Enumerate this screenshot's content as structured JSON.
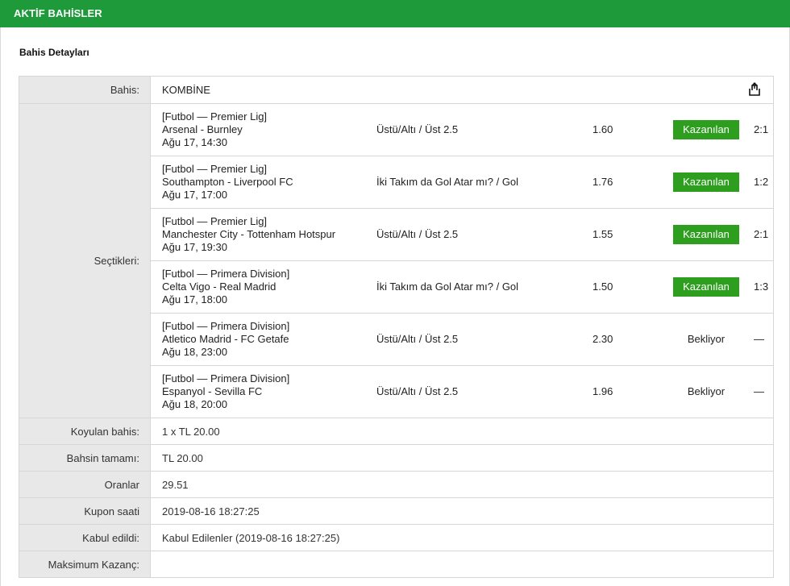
{
  "header": {
    "title": "AKTİF BAHİSLER"
  },
  "section_title": "Bahis Detayları",
  "bet": {
    "label": "Bahis:",
    "type": "KOMBİNE"
  },
  "selections": {
    "label": "Seçtikleri:",
    "items": [
      {
        "league": "[Futbol — Premier Lig]",
        "match": "Arsenal - Burnley",
        "date": "Ağu 17, 14:30",
        "market": "Üstü/Altı / Üst 2.5",
        "odds": "1.60",
        "status": "Kazanılan",
        "won": true,
        "score": "2:1"
      },
      {
        "league": "[Futbol — Premier Lig]",
        "match": "Southampton - Liverpool FC",
        "date": "Ağu 17, 17:00",
        "market": "İki Takım da Gol Atar mı? / Gol",
        "odds": "1.76",
        "status": "Kazanılan",
        "won": true,
        "score": "1:2"
      },
      {
        "league": "[Futbol — Premier Lig]",
        "match": "Manchester City - Tottenham Hotspur",
        "date": "Ağu 17, 19:30",
        "market": "Üstü/Altı / Üst 2.5",
        "odds": "1.55",
        "status": "Kazanılan",
        "won": true,
        "score": "2:1"
      },
      {
        "league": "[Futbol — Primera Division]",
        "match": "Celta Vigo - Real Madrid",
        "date": "Ağu 17, 18:00",
        "market": "İki Takım da Gol Atar mı? / Gol",
        "odds": "1.50",
        "status": "Kazanılan",
        "won": true,
        "score": "1:3"
      },
      {
        "league": "[Futbol — Primera Division]",
        "match": "Atletico Madrid - FC Getafe",
        "date": "Ağu 18, 23:00",
        "market": "Üstü/Altı / Üst 2.5",
        "odds": "2.30",
        "status": "Bekliyor",
        "won": false,
        "score": "—"
      },
      {
        "league": "[Futbol — Primera Division]",
        "match": "Espanyol - Sevilla FC",
        "date": "Ağu 18, 20:00",
        "market": "Üstü/Altı / Üst 2.5",
        "odds": "1.96",
        "status": "Bekliyor",
        "won": false,
        "score": "—"
      }
    ]
  },
  "stake": {
    "label": "Koyulan bahis:",
    "value": "1 x TL 20.00"
  },
  "total": {
    "label": "Bahsin tamamı:",
    "value": "TL 20.00"
  },
  "odds": {
    "label": "Oranlar",
    "value": "29.51"
  },
  "coupon_time": {
    "label": "Kupon saati",
    "value": "2019-08-16 18:27:25"
  },
  "accepted": {
    "label": "Kabul edildi:",
    "value": "Kabul Edilenler (2019-08-16 18:27:25)"
  },
  "max_win": {
    "label": "Maksimum Kazanç:",
    "value": ""
  },
  "colors": {
    "header": "#1f9a3b",
    "won_badge": "#2e9e1f",
    "label_bg": "#e8e8e8"
  },
  "icons": {
    "share": "share-icon"
  }
}
